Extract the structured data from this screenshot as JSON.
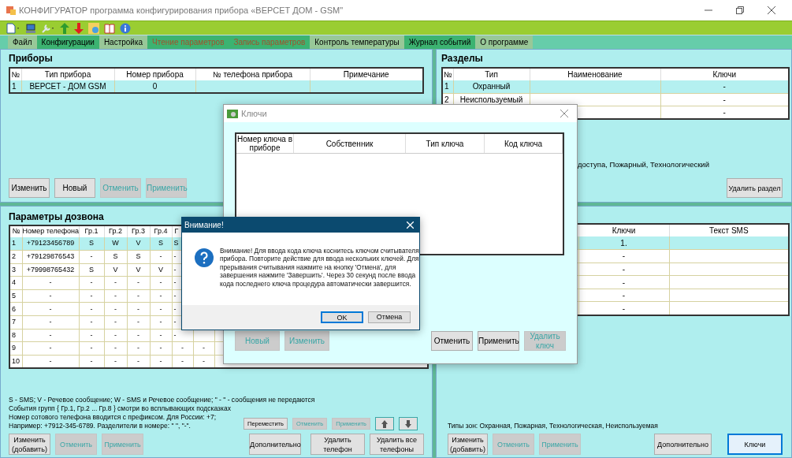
{
  "window": {
    "title": "КОНФИГУРАТОР программа конфигурирования прибора «ВЕРСЕТ ДОМ - GSM\""
  },
  "menu": [
    {
      "label": "Файл",
      "color": "#98c898",
      "disabled": false
    },
    {
      "label": "Конфигурации",
      "color": "#3cb371",
      "disabled": false
    },
    {
      "label": "Настройка",
      "color": "#98c898",
      "disabled": false
    },
    {
      "label": "Чтение параметров",
      "color": "#3cb371",
      "disabled": true
    },
    {
      "label": "Запись параметров",
      "color": "#3cb371",
      "disabled": true
    },
    {
      "label": "Контроль температуры",
      "color": "#98c898",
      "disabled": false
    },
    {
      "label": "Журнал событий",
      "color": "#3cb371",
      "disabled": false
    },
    {
      "label": "О программе",
      "color": "#98c898",
      "disabled": false
    }
  ],
  "devices": {
    "title": "Приборы",
    "columns": [
      "№",
      "Тип прибора",
      "Номер прибора",
      "№ телефона прибора",
      "Примечание"
    ],
    "rows": [
      {
        "selected": true,
        "cells": [
          "1",
          "ВЕРСЕТ - ДОМ GSM",
          "0"
        ]
      }
    ],
    "buttons": [
      {
        "label": "Изменить",
        "disabled": false
      },
      {
        "label": "Новый",
        "disabled": false
      },
      {
        "label": "Отменить",
        "disabled": true
      },
      {
        "label": "Применить",
        "disabled": true
      }
    ]
  },
  "sections": {
    "title": "Разделы",
    "columns": [
      "№",
      "Тип",
      "Наименование",
      "Ключи"
    ],
    "rows": [
      {
        "selected": true,
        "num": "1",
        "type": "Охранный",
        "keys": "-"
      },
      {
        "selected": false,
        "num": "2",
        "type": "Неиспользуемый",
        "keys": "-"
      },
      {
        "selected": false,
        "keys": "-"
      }
    ],
    "note": "доступа, Пожарный, Технологический",
    "delete_button": "Удалить раздел"
  },
  "dialing": {
    "title": "Параметры дозвона",
    "columns": [
      "№",
      "Номер телефона",
      "Гр.1",
      "Гр.2",
      "Гр.3",
      "Гр.4",
      "Г"
    ],
    "rows": [
      {
        "selected": true,
        "cells": [
          "1",
          "+79123456789",
          "S",
          "W",
          "V",
          "S",
          "S"
        ]
      },
      {
        "selected": false,
        "cells": [
          "2",
          "+79129876543",
          "-",
          "S",
          "S",
          "-",
          "-"
        ]
      },
      {
        "selected": false,
        "cells": [
          "3",
          "+79998765432",
          "S",
          "V",
          "V",
          "V",
          "-"
        ]
      },
      {
        "selected": false,
        "cells": [
          "4",
          "-",
          "-",
          "-",
          "-",
          "-",
          "-"
        ]
      },
      {
        "selected": false,
        "cells": [
          "5",
          "-",
          "-",
          "-",
          "-",
          "-",
          "-"
        ]
      },
      {
        "selected": false,
        "cells": [
          "6",
          "-",
          "-",
          "-",
          "-",
          "-",
          "-"
        ]
      },
      {
        "selected": false,
        "cells": [
          "7",
          "-",
          "-",
          "-",
          "-",
          "-",
          "-"
        ]
      },
      {
        "selected": false,
        "cells": [
          "8",
          "-",
          "-",
          "-",
          "-",
          "-",
          "-"
        ]
      },
      {
        "selected": false,
        "cells": [
          "9",
          "-",
          "-",
          "-",
          "-",
          "-",
          "-",
          "-"
        ]
      },
      {
        "selected": false,
        "cells": [
          "10",
          "-",
          "-",
          "-",
          "-",
          "-",
          "-",
          "-"
        ]
      }
    ],
    "legend": [
      "S - SMS;   V - Речевое сообщение;   W - SMS и Речевое сообщение; \" - \" - сообщения не передаются",
      "События групп { Гр.1, Гр.2 ... Гр.8 } смотри во всплывающих подсказках",
      "Номер сотового телефона вводится с префиксом. Для России: +7;",
      "Например: +7912-345-6789. Разделители в номере: \" \", \"-\"."
    ],
    "small_buttons": [
      {
        "kind": "text",
        "label": "Переместить",
        "disabled": false
      },
      {
        "kind": "text",
        "label": "Отменить",
        "disabled": true
      },
      {
        "kind": "text",
        "label": "Применить",
        "disabled": true
      },
      {
        "kind": "up"
      },
      {
        "kind": "down"
      }
    ],
    "buttons": [
      {
        "label": "Изменить (добавить)",
        "disabled": false
      },
      {
        "label": "Отменить",
        "disabled": true
      },
      {
        "label": "Применить",
        "disabled": true
      }
    ],
    "right_buttons": [
      {
        "label": "Дополнительно",
        "disabled": false
      },
      {
        "label": "Удалить телефон",
        "disabled": false
      },
      {
        "label": "Удалить все телефоны",
        "disabled": false
      }
    ]
  },
  "zones": {
    "columns": [
      "Ключи",
      "Текст SMS"
    ],
    "rows": [
      {
        "selected": true,
        "keys": "1."
      },
      {
        "selected": false,
        "keys": "-"
      },
      {
        "selected": false,
        "keys": "-"
      },
      {
        "selected": false,
        "keys": "-"
      },
      {
        "selected": false,
        "keys": "-"
      },
      {
        "selected": false,
        "keys": "-"
      }
    ],
    "note": "Типы зон: Охранная, Пожарная, Технологическая, Неиспользуемая",
    "buttons": [
      {
        "label": "Изменить (добавить)",
        "disabled": false
      },
      {
        "label": "Отменить",
        "disabled": true
      },
      {
        "label": "Применить",
        "disabled": true
      }
    ],
    "right_buttons": [
      {
        "label": "Дополнительно",
        "disabled": false,
        "focused": false
      },
      {
        "label": "Ключи",
        "disabled": false,
        "focused": true
      }
    ]
  },
  "keys_dialog": {
    "title": "Ключи",
    "columns": [
      "Номер ключа в приборе",
      "Собственник",
      "Тип ключа",
      "Код ключа"
    ],
    "left_buttons": [
      {
        "label": "Новый",
        "disabled": true
      },
      {
        "label": "Изменить",
        "disabled": true
      }
    ],
    "right_buttons": [
      {
        "label": "Отменить",
        "disabled": false
      },
      {
        "label": "Применить",
        "disabled": false
      },
      {
        "label": "Удалить ключ",
        "disabled": true
      }
    ]
  },
  "alert": {
    "title": "Внимание!",
    "message": "Внимание! Для ввода кода ключа коснитесь ключом считывателя прибора. Повторите действие для ввода нескольких ключей. Для прерывания считывания нажмите на кнопку 'Отмена',  для завершения нажмите 'Завершить'. Через 30 секунд после ввода кода последнего ключа процедура автоматически завершится.",
    "buttons": [
      {
        "label": "OK",
        "default": true
      },
      {
        "label": "Отмена",
        "default": false
      }
    ]
  }
}
